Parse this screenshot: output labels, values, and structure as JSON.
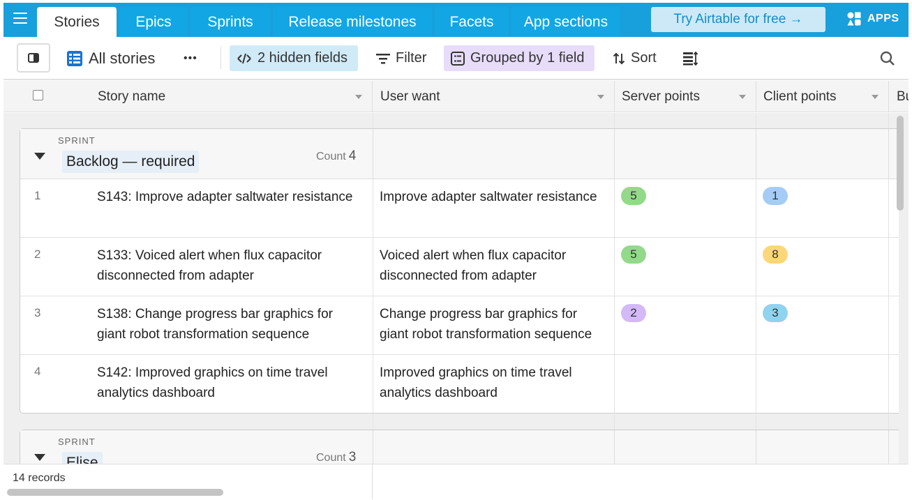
{
  "tabs": [
    {
      "label": "Stories",
      "active": true
    },
    {
      "label": "Epics"
    },
    {
      "label": "Sprints"
    },
    {
      "label": "Release milestones"
    },
    {
      "label": "Facets"
    },
    {
      "label": "App sections"
    }
  ],
  "try_button": "Try Airtable for free →",
  "apps_label": "APPS",
  "toolbar": {
    "view_name": "All stories",
    "more": "•••",
    "hidden_fields": "2 hidden fields",
    "filter": "Filter",
    "grouped": "Grouped by 1 field",
    "sort": "Sort"
  },
  "columns": [
    {
      "label": "Story name"
    },
    {
      "label": "User want"
    },
    {
      "label": "Server points"
    },
    {
      "label": "Client points"
    },
    {
      "label": "Bu"
    }
  ],
  "groups": [
    {
      "field_label": "SPRINT",
      "value": "Backlog — required",
      "count_label": "Count",
      "count": "4",
      "rows": [
        {
          "num": "1",
          "story": "S143: Improve adapter saltwater resistance",
          "want": "Improve adapter saltwater resistance",
          "server": "5",
          "client": "1"
        },
        {
          "num": "2",
          "story": "S133: Voiced alert when flux capacitor disconnected from adapter",
          "want": "Voiced alert when flux capacitor disconnected from adapter",
          "server": "5",
          "client": "8"
        },
        {
          "num": "3",
          "story": "S138: Change progress bar graphics for giant robot transformation sequence",
          "want": "Change progress bar graphics for giant robot transformation sequence",
          "server": "2",
          "client": "3"
        },
        {
          "num": "4",
          "story": "S142: Improved graphics on time travel analytics dashboard",
          "want": "Improved graphics on time travel analytics dashboard",
          "server": "",
          "client": ""
        }
      ]
    },
    {
      "field_label": "SPRINT",
      "value": "Elise",
      "count_label": "Count",
      "count": "3"
    }
  ],
  "footer": {
    "records": "14 records"
  },
  "colors": {
    "topbar": "#18a0dc",
    "pill_green": "#93d98a",
    "pill_blue": "#a5ccf5",
    "pill_yellow": "#fcd67a",
    "pill_purple": "#d3b9f6",
    "pill_cyan": "#8fd3ef"
  }
}
